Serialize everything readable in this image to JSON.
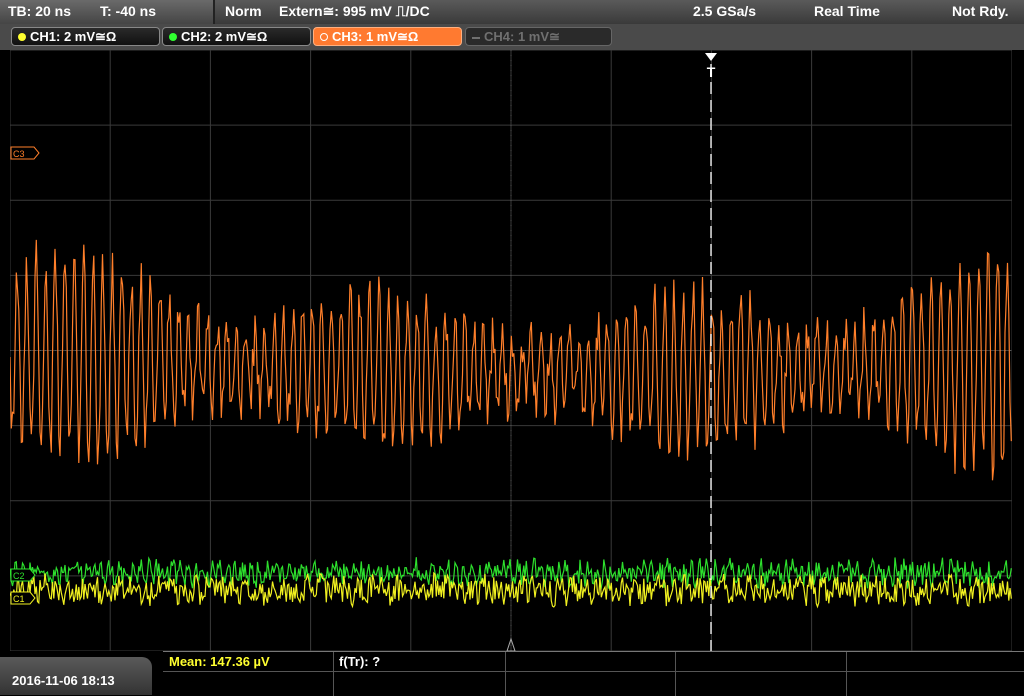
{
  "status_bar": {
    "timebase": "TB: 20 ns",
    "trigger_time": "T: -40 ns",
    "trigger_mode": "Norm",
    "trigger_source": "Extern≅: 995 mV ⎍/DC",
    "sample_rate": "2.5 GSa/s",
    "acq_mode": "Real Time",
    "status": "Not Rdy."
  },
  "channels": [
    {
      "label": "CH1: 2 mV≅Ω",
      "color": "#ffff30",
      "active": true
    },
    {
      "label": "CH2: 2 mV≅Ω",
      "color": "#30ff30",
      "active": true
    },
    {
      "label": "CH3: 1 mV≅Ω",
      "color": "#ff8030",
      "active": true,
      "selected": true
    },
    {
      "label": "CH4: 1 mV≅",
      "color": "#808080",
      "active": false
    }
  ],
  "markers": {
    "ch3_ref": "C3",
    "ch1_ref": "C1",
    "ch2_ref": "C2",
    "trigger": "T"
  },
  "footer": {
    "datetime": "2016-11-06 18:13",
    "mean": "Mean: 147.36 µV",
    "ftr": "f(Tr): ?"
  }
}
